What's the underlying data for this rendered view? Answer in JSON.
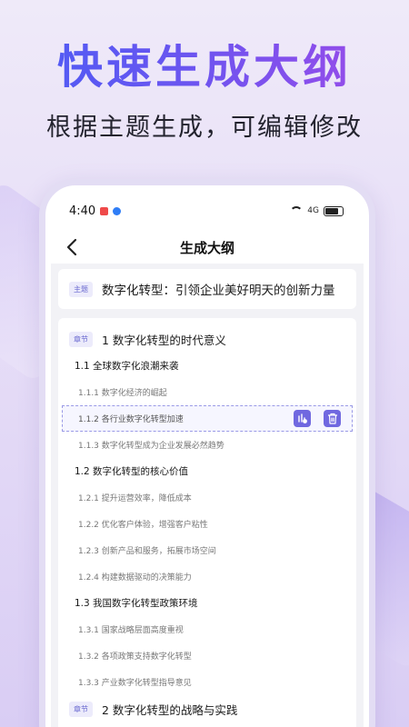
{
  "hero": {
    "title": "快速生成大纲",
    "subtitle": "根据主题生成，可编辑修改"
  },
  "status_bar": {
    "time": "4:40",
    "signal": "4G"
  },
  "nav": {
    "back_icon": "chevron-left-icon",
    "title": "生成大纲"
  },
  "topic": {
    "tag": "主题",
    "text": "数字化转型：引领企业美好明天的创新力量"
  },
  "outline": {
    "chapter_tag": "章节",
    "chapter1": "1 数字化转型的时代意义",
    "s1_1": "1.1 全球数字化浪潮来袭",
    "i1_1_1": "1.1.1 数字化经济的崛起",
    "i1_1_2": "1.1.2 各行业数字化转型加速",
    "i1_1_3": "1.1.3 数字化转型成为企业发展必然趋势",
    "s1_2": "1.2 数字化转型的核心价值",
    "i1_2_1": "1.2.1 提升运营效率，降低成本",
    "i1_2_2": "1.2.2 优化客户体验，增强客户粘性",
    "i1_2_3": "1.2.3 创新产品和服务，拓展市场空间",
    "i1_2_4": "1.2.4 构建数据驱动的决策能力",
    "s1_3": "1.3 我国数字化转型政策环境",
    "i1_3_1": "1.3.1 国家战略层面高度重视",
    "i1_3_2": "1.3.2 各项政策支持数字化转型",
    "i1_3_3": "1.3.3 产业数字化转型指导意见",
    "chapter2": "2 数字化转型的战略与实践"
  },
  "colors": {
    "accent": "#7068e0",
    "title_gradient_start": "#4a5cf5",
    "title_gradient_end": "#a04ae8"
  }
}
